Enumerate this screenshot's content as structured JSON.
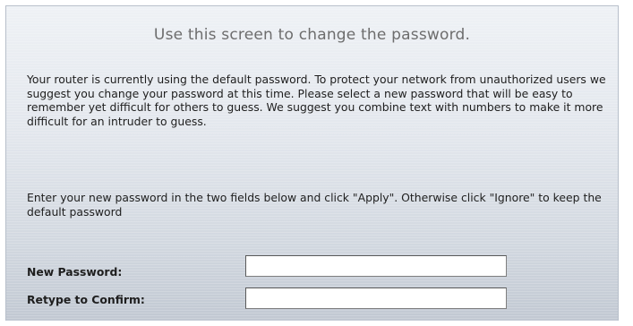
{
  "screen": {
    "title": "Use this screen to change the password.",
    "intro": "Your router is currently using the default password. To protect your network from unauthorized users we suggest you change your password at this time. Please select a new password that will be easy to remember yet difficult for others to guess. We suggest you combine text with numbers to make it more difficult for an intruder to guess.",
    "instructions": "Enter your new password in the two fields below and click \"Apply\". Otherwise click \"Ignore\" to keep the default password"
  },
  "form": {
    "new_password": {
      "label": "New Password:",
      "value": ""
    },
    "confirm_password": {
      "label": "Retype to Confirm:",
      "value": ""
    }
  }
}
